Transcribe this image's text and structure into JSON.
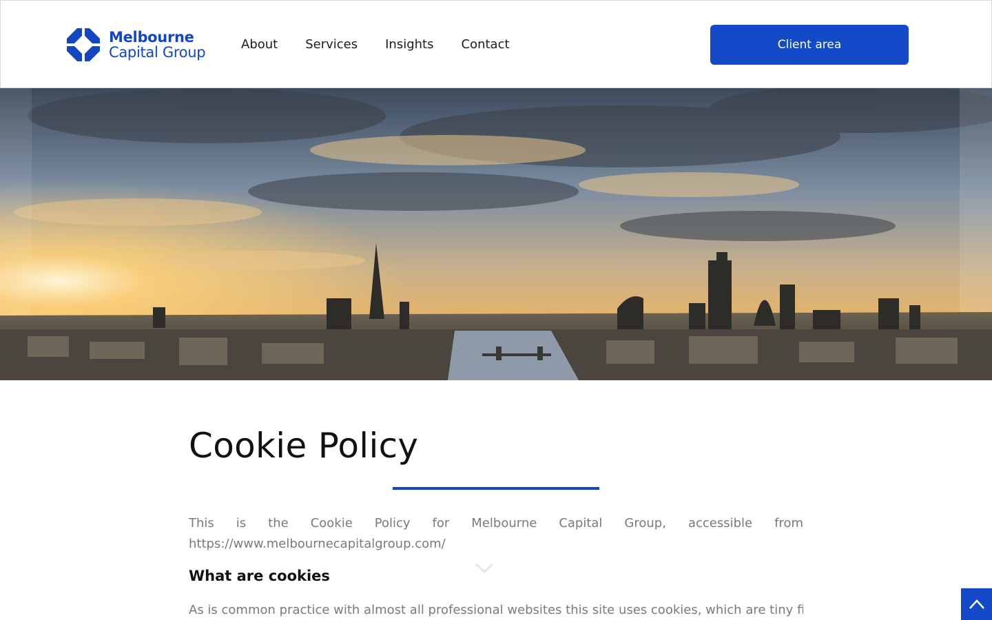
{
  "header": {
    "logo": {
      "line1": "Melbourne",
      "line2": "Capital Group",
      "icon": "logo-mark-icon"
    },
    "nav": [
      {
        "label": "About"
      },
      {
        "label": "Services"
      },
      {
        "label": "Insights"
      },
      {
        "label": "Contact"
      }
    ],
    "client_button": "Client area"
  },
  "hero": {
    "image": "city-skyline-at-sunset"
  },
  "main": {
    "title": "Cookie Policy",
    "intro": "This is the Cookie Policy for Melbourne Capital Group, accessible from https://www.melbournecapitalgroup.com/",
    "section_heading": "What are cookies",
    "section_text": "As is common practice with almost all professional websites this site uses cookies, which are tiny files"
  },
  "colors": {
    "accent": "#1449c8",
    "text": "#1c1c1c",
    "muted": "#7a7a7a"
  },
  "icons": {
    "scroll_hint": "chevron-down-icon",
    "back_to_top": "chevron-up-icon"
  }
}
